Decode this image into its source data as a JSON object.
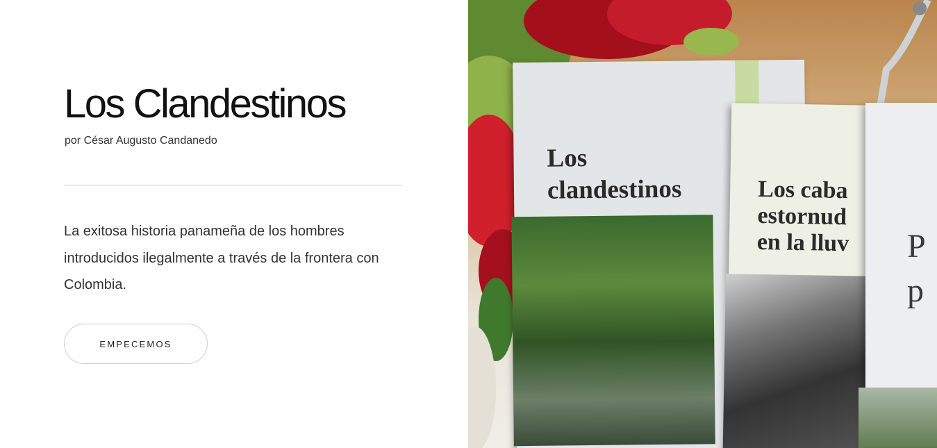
{
  "hero": {
    "title": "Los Clandestinos",
    "author": "por César Augusto Candanedo",
    "description": "La exitosa historia panameña de los hombres introducidos ilegalmente a través de la frontera con Colombia.",
    "cta_label": "EMPECEMOS"
  },
  "photo": {
    "book1_title_line1": "Los",
    "book1_title_line2": "clandestinos",
    "book2_title_line1": "Los caba",
    "book2_title_line2": "estornud",
    "book2_title_line3": "en la lluv",
    "book3_title_line1": "P",
    "book3_title_line2": "p"
  },
  "colors": {
    "accent_text": "#111111",
    "button_border": "#cfcfcf"
  }
}
